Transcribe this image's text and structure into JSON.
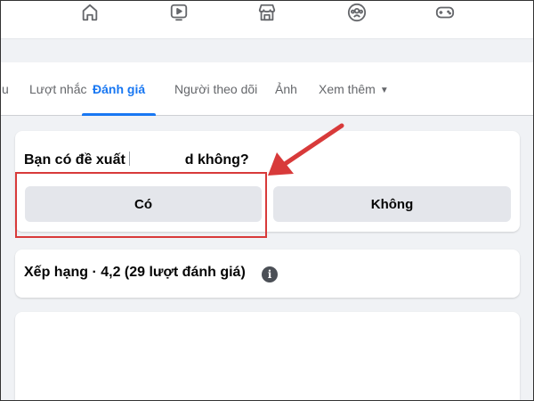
{
  "nav": {
    "icons": [
      "home-icon",
      "watch-icon",
      "marketplace-icon",
      "groups-icon",
      "gaming-icon"
    ]
  },
  "tabs": [
    {
      "label": "u"
    },
    {
      "label": "Lượt nhắc"
    },
    {
      "label": "Đánh giá"
    },
    {
      "label": "Người theo dõi"
    },
    {
      "label": "Ảnh"
    },
    {
      "label": "Xem thêm"
    }
  ],
  "recommend": {
    "question_start": "Bạn có đề xuất",
    "question_end": "d không?",
    "yes_label": "Có",
    "no_label": "Không"
  },
  "rating": {
    "label": "Xếp hạng · 4,2 (29 lượt đánh giá)"
  },
  "colors": {
    "accent": "#1877f2",
    "highlight": "#d83a3a",
    "background": "#f0f2f5"
  }
}
